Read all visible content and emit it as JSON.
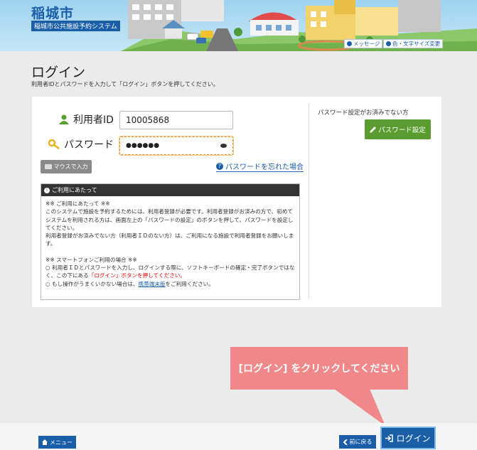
{
  "header": {
    "site_title": "稲城市",
    "site_subtitle": "稲城市公共施設予約システム",
    "message_link": "メッセージ",
    "color_size_link": "色・文字サイズ変更"
  },
  "page": {
    "title": "ログイン",
    "description": "利用者IDとパスワードを入力して「ログイン」ボタンを押してください。"
  },
  "login_form": {
    "user_id_label": "利用者ID",
    "user_id_value": "10005868",
    "password_label": "パスワード",
    "password_value": "●●●●●●",
    "mouse_input_label": "マウスで入力",
    "forgot_password_link": "パスワードを忘れた場合"
  },
  "notice": {
    "header": "ご利用にあたって",
    "line1": "※※ ご利用にあたって ※※",
    "line2": "このシステムで施設を予約するためには、利用者登録が必要です。利用者登録がお済みの方で、初めてシステムを利用される方は、画面左上の「パスワードの設定」のボタンを押して、パスワードを設定してください。",
    "line3": "利用者登録がお済みでない方（利用者ＩＤのない方）は、ご利用になる施設で利用者登録をお願いします。",
    "line4": "※※ スマートフォンご利用の場合 ※※",
    "line5a": "○ 利用者ＩＤとパスワードを入力し、ログインする際に、ソフトキーボードの確定・完了ボタンではなく、この下にある",
    "line5b": "「ログイン」ボタンを押してください。",
    "line6a": "○ もし操作がうまくいかない場合は、",
    "line6b": "携帯端末版",
    "line6c": "をご利用ください。"
  },
  "sidebar": {
    "note": "パスワード設定がお済みでない方",
    "password_setup_button": "パスワード設定"
  },
  "callout": {
    "text": "[ログイン] をクリックしてください"
  },
  "footer": {
    "menu_button": "メニュー",
    "back_button": "前に戻る",
    "login_button": "ログイン"
  },
  "colors": {
    "primary": "#1a5ea8",
    "green_button": "#5b9c30",
    "callout": "#f08789",
    "alert_text": "#ee0000"
  }
}
